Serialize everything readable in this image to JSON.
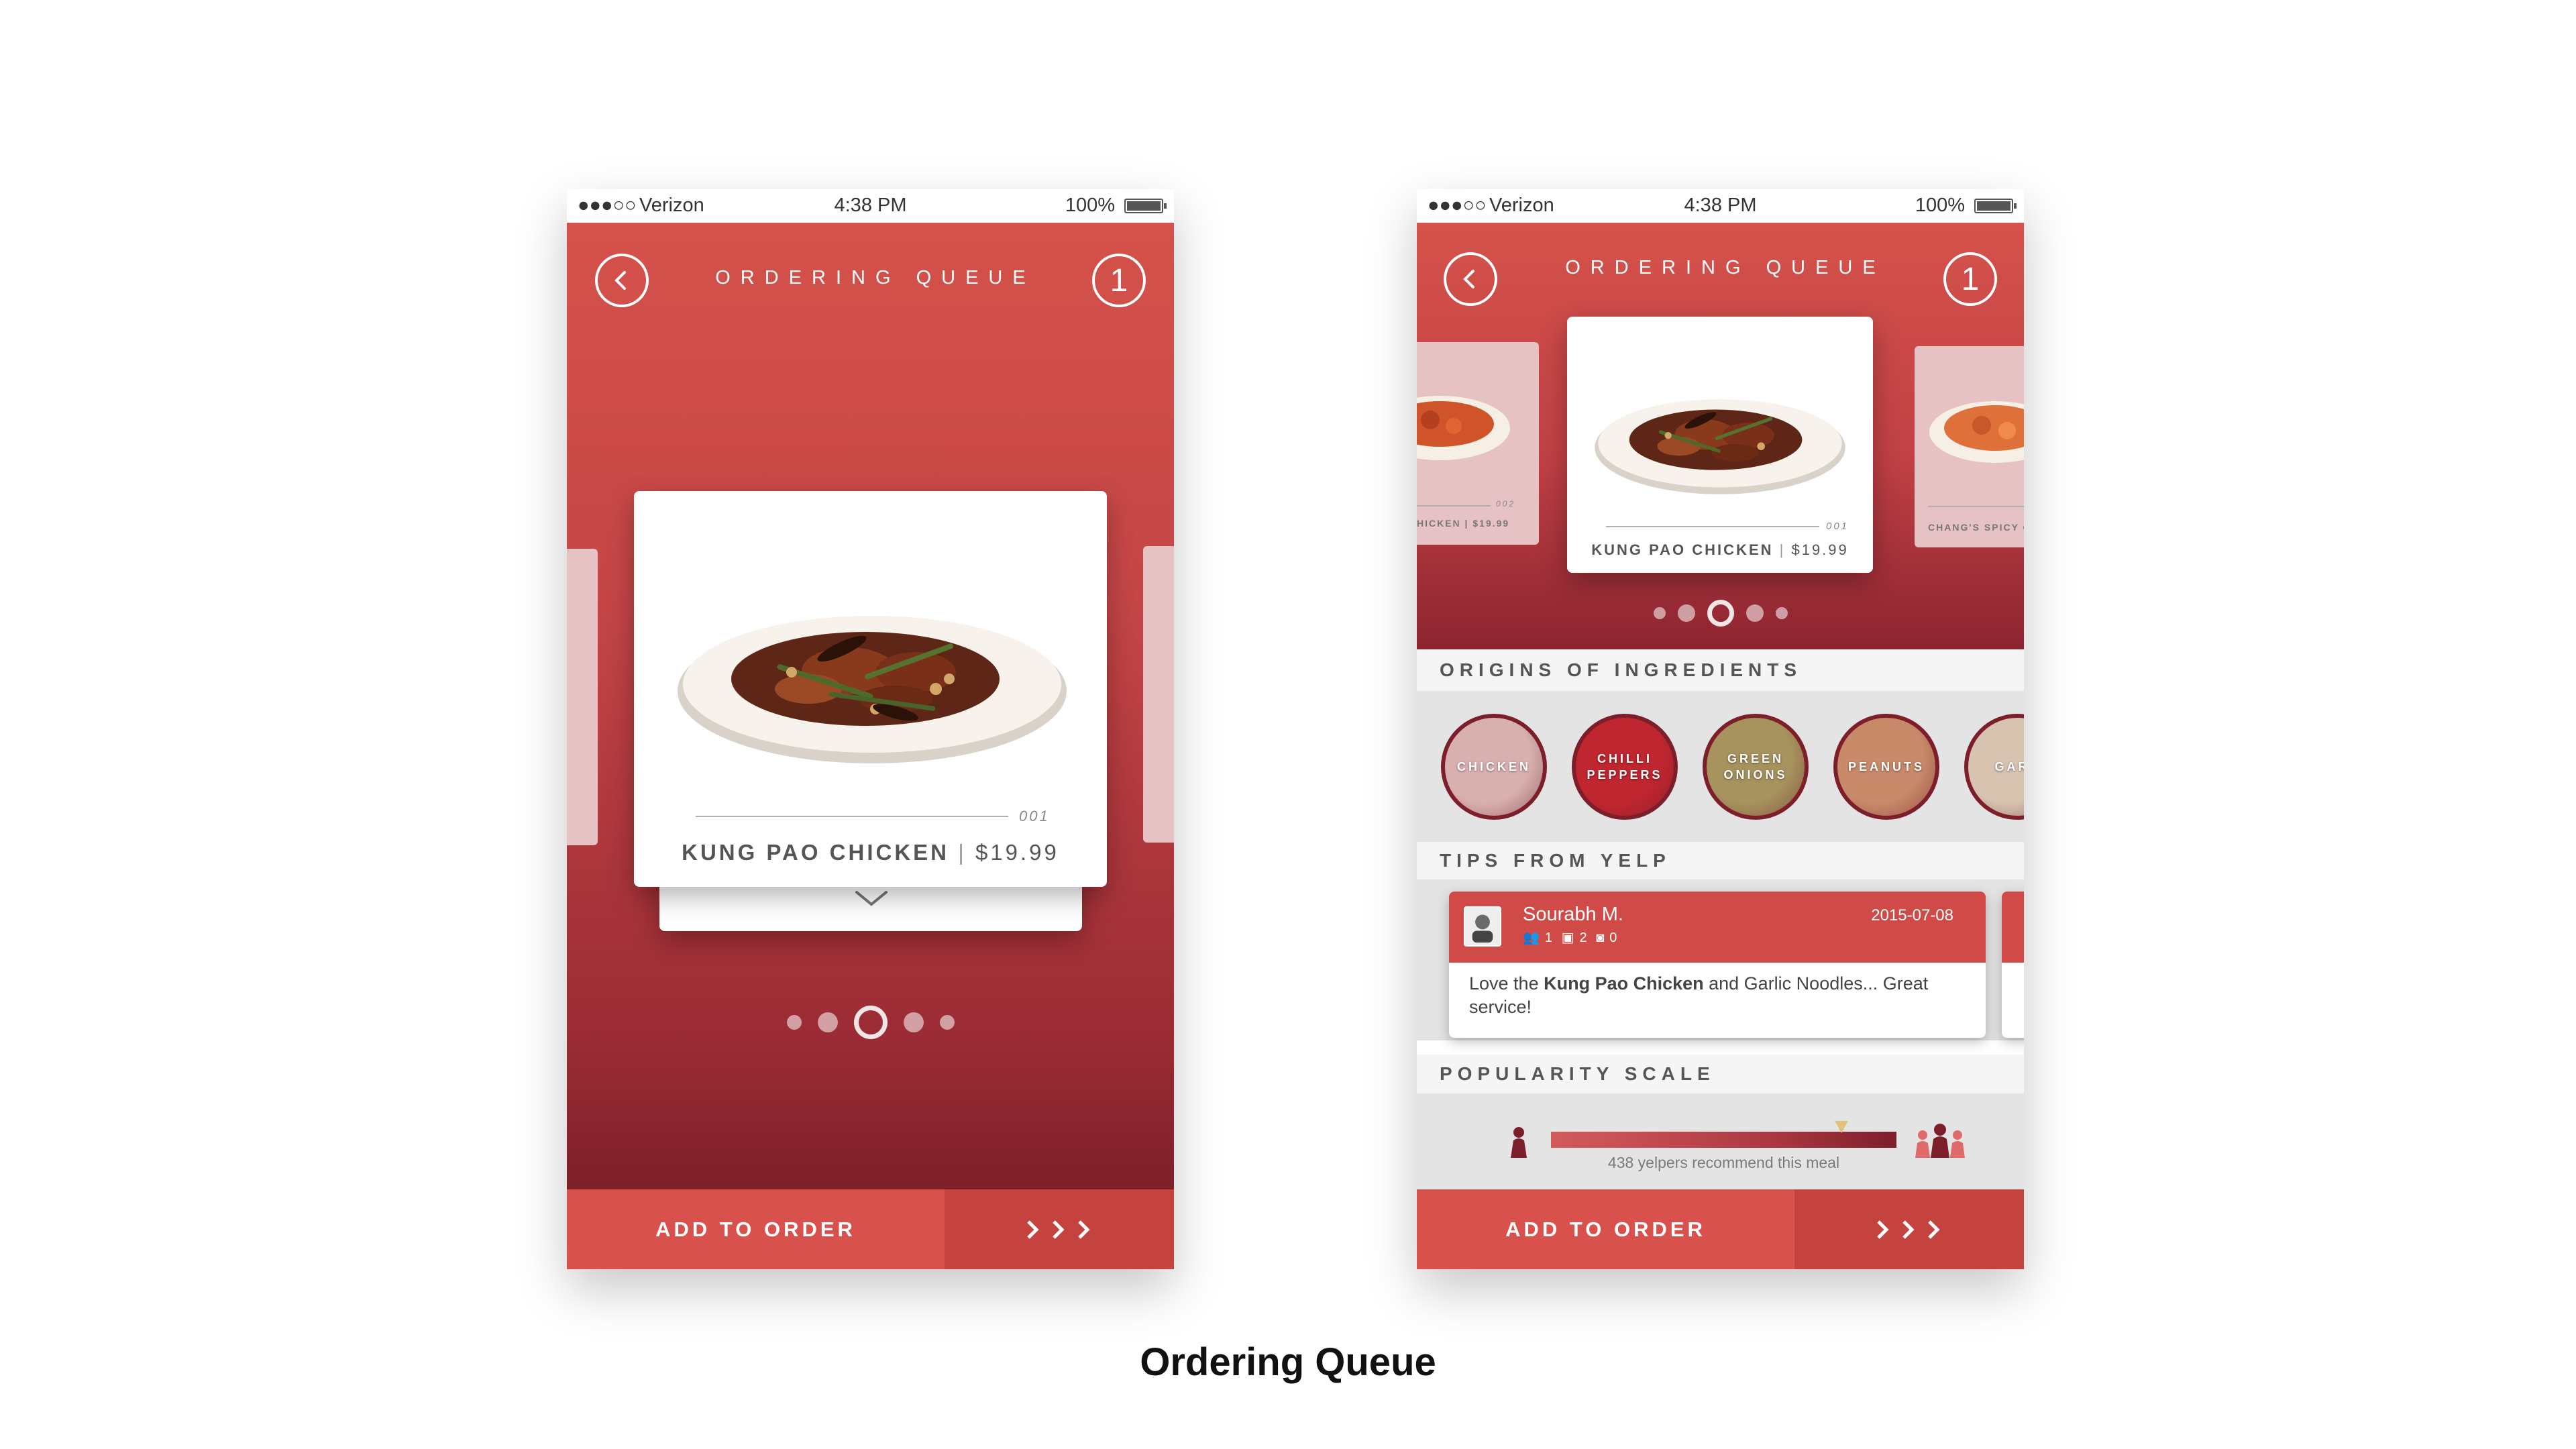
{
  "caption": "Ordering Queue",
  "colors": {
    "primary": "#d8514c",
    "dark": "#7d1f2a",
    "secondary_button": "#c4433f"
  },
  "status_bar": {
    "carrier": "Verizon",
    "signal": "●●●○○",
    "time": "4:38 PM",
    "battery": "100%"
  },
  "header": {
    "title": "ORDERING QUEUE",
    "queue_count": "1",
    "back_icon": "chevron-left-icon"
  },
  "card": {
    "number": "001",
    "name": "KUNG PAO CHICKEN",
    "separator": "|",
    "price": "$19.99"
  },
  "side_cards": {
    "left_label": "HICKEN | $19.99",
    "left_number": "002",
    "right_label": "CHANG'S SPICY C"
  },
  "pagination": {
    "count": 5,
    "active_index": 2
  },
  "bottom_bar": {
    "add_label": "ADD TO ORDER",
    "next_icon": "triple-chevron-right-icon"
  },
  "ingredients": {
    "title": "ORIGINS OF INGREDIENTS",
    "items": [
      {
        "label_lines": [
          "CHICKEN"
        ],
        "color": "#d9b0b0"
      },
      {
        "label_lines": [
          "CHILLI",
          "PEPPERS"
        ],
        "color": "#c0262f"
      },
      {
        "label_lines": [
          "GREEN",
          "ONIONS"
        ],
        "color": "#a7935e"
      },
      {
        "label_lines": [
          "PEANUTS"
        ],
        "color": "#c98a6a"
      },
      {
        "label_lines": [
          "GARL"
        ],
        "color": "#d7c3b0"
      }
    ]
  },
  "tips": {
    "title": "TIPS FROM YELP",
    "items": [
      {
        "name": "Sourabh M.",
        "date": "2015-07-08",
        "friends": "1",
        "reviews": "2",
        "photos": "0",
        "text_before": "Love the ",
        "text_bold": "Kung Pao Chicken",
        "text_after": " and Garlic Noodles... Great service!"
      }
    ]
  },
  "popularity": {
    "title": "POPULARITY SCALE",
    "caption": "438 yelpers recommend this meal",
    "level": 0.84
  }
}
